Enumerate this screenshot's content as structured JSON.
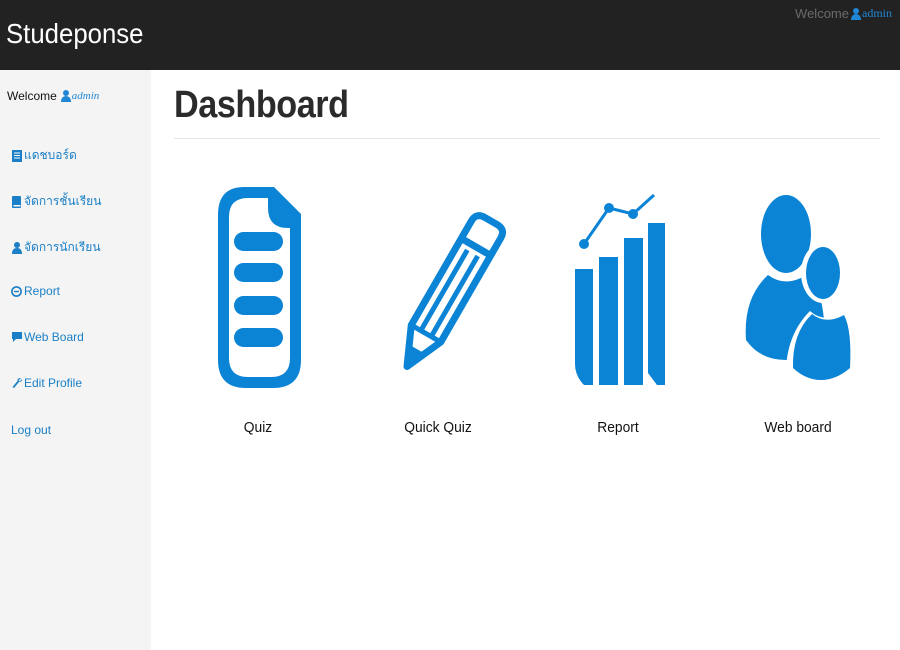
{
  "app": {
    "brand": "Studeponse"
  },
  "topbar": {
    "welcome_label": "Welcome",
    "user": "admin"
  },
  "sidebar": {
    "welcome_label": "Welcome",
    "user": "admin",
    "items": [
      {
        "label": "แดชบอร์ด",
        "icon": "list-icon"
      },
      {
        "label": "จัดการชั้นเรียน",
        "icon": "book-icon"
      },
      {
        "label": "จัดการนักเรียน",
        "icon": "user-icon"
      },
      {
        "label": "Report",
        "icon": "circle-minus-icon"
      },
      {
        "label": "Web Board",
        "icon": "comment-icon"
      },
      {
        "label": "Edit Profile",
        "icon": "wrench-icon"
      },
      {
        "label": "Log out",
        "icon": ""
      }
    ]
  },
  "main": {
    "title": "Dashboard",
    "tiles": [
      {
        "label": "Quiz",
        "icon": "document-icon"
      },
      {
        "label": "Quick Quiz",
        "icon": "pencil-icon"
      },
      {
        "label": "Report",
        "icon": "bar-chart-icon"
      },
      {
        "label": "Web board",
        "icon": "users-icon"
      }
    ]
  },
  "colors": {
    "accent": "#0b84d6",
    "topbar": "#222222",
    "sidebar": "#f4f4f4",
    "link": "#1a7fc6"
  }
}
